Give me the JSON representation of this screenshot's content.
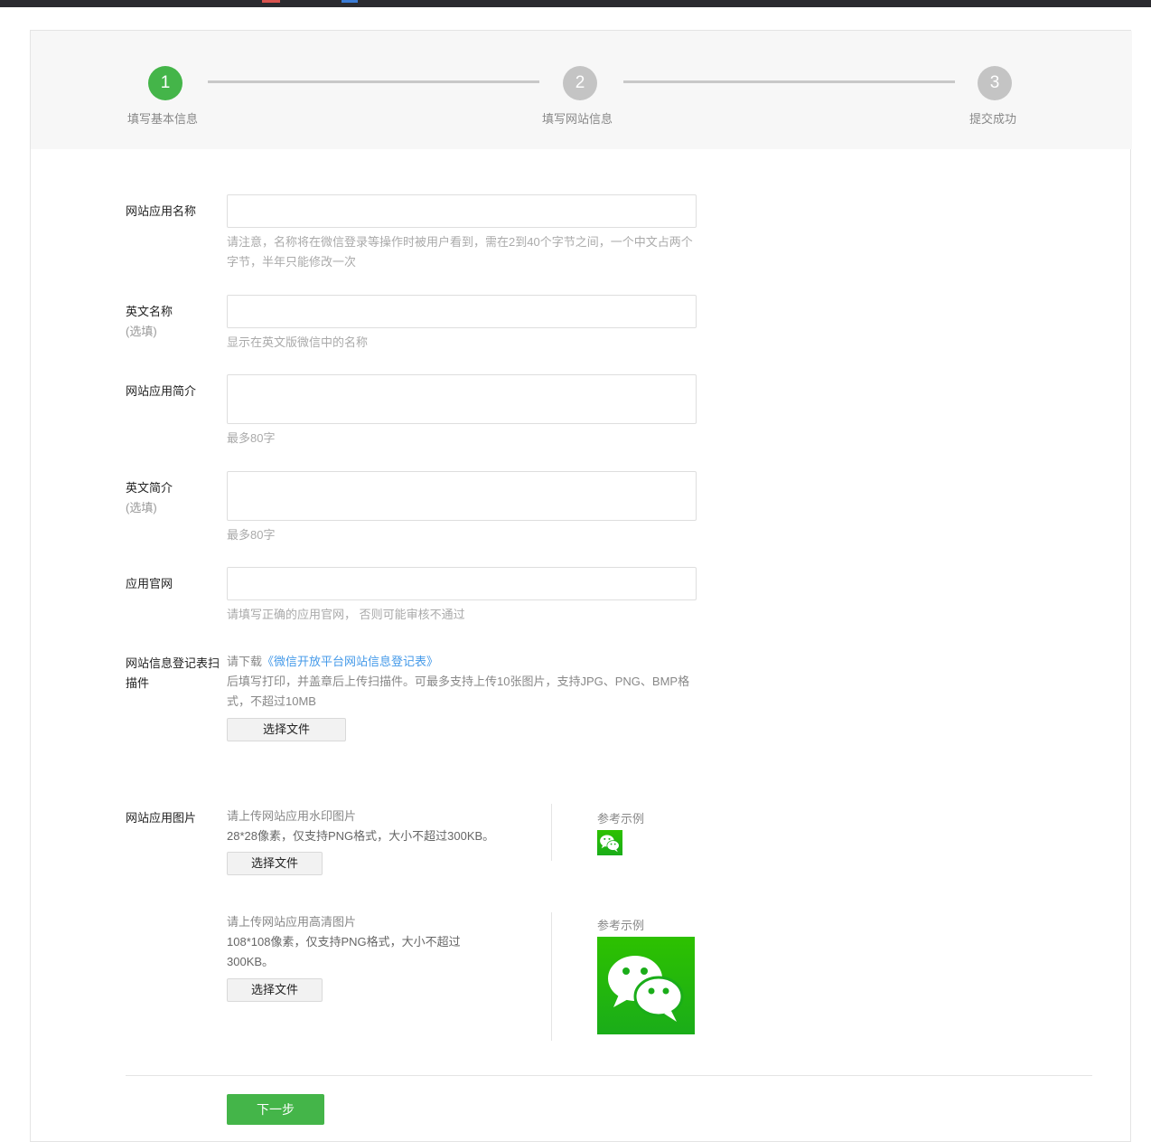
{
  "steps": [
    {
      "number": "1",
      "label": "填写基本信息"
    },
    {
      "number": "2",
      "label": "填写网站信息"
    },
    {
      "number": "3",
      "label": "提交成功"
    }
  ],
  "current_step": 1,
  "fields": {
    "app_name": {
      "label": "网站应用名称",
      "value": "",
      "hint": "请注意，名称将在微信登录等操作时被用户看到，需在2到40个字节之间，一个中文占两个字节，半年只能修改一次"
    },
    "english_name": {
      "label": "英文名称",
      "optional": "(选填)",
      "value": "",
      "hint": "显示在英文版微信中的名称"
    },
    "app_intro": {
      "label": "网站应用简介",
      "value": "",
      "hint": "最多80字"
    },
    "english_intro": {
      "label": "英文简介",
      "optional": "(选填)",
      "value": "",
      "hint": "最多80字"
    },
    "website": {
      "label": "应用官网",
      "value": "",
      "hint": "请填写正确的应用官网， 否则可能审核不通过"
    },
    "registration_form": {
      "label": "网站信息登记表扫描件",
      "download_prefix": "请下载",
      "download_link": "《微信开放平台网站信息登记表》",
      "instructions": "后填写打印，并盖章后上传扫描件。可最多支持上传10张图片，支持JPG、PNG、BMP格式，不超过10MB",
      "button": "选择文件"
    },
    "app_images": {
      "label": "网站应用图片",
      "watermark": {
        "title": "请上传网站应用水印图片",
        "spec": "28*28像素，仅支持PNG格式，大小不超过300KB。",
        "button": "选择文件",
        "example_label": "参考示例"
      },
      "hd": {
        "title": "请上传网站应用高清图片",
        "spec": "108*108像素，仅支持PNG格式，大小不超过300KB。",
        "button": "选择文件",
        "example_label": "参考示例"
      }
    }
  },
  "next_button": "下一步",
  "colors": {
    "accent": "#44b549",
    "inactive_step": "#c4c4c4",
    "link": "#459ae9",
    "wechat_green": "#1aad19"
  }
}
